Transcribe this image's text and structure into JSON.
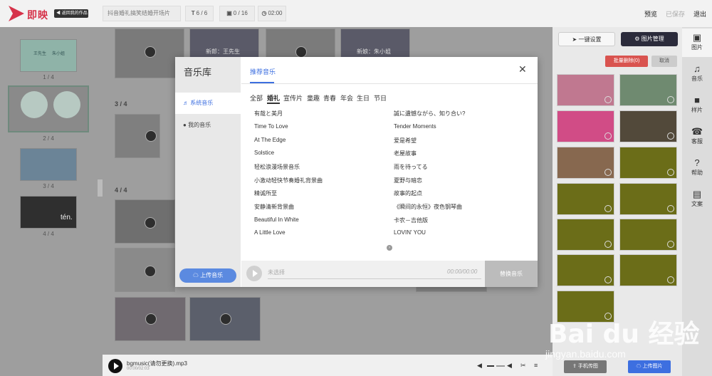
{
  "app": {
    "logo_text": "即映",
    "back_label": "返回我的作品",
    "project_title": "抖音婚礼搞笑结婚开场片",
    "text_count": "6 / 6",
    "image_count": "0 / 16",
    "duration": "02:00",
    "preview_label": "预览",
    "saved_label": "已保存",
    "exit_label": "退出"
  },
  "pages": {
    "labels": [
      "1 / 4",
      "2 / 4",
      "3 / 4",
      "4 / 4"
    ],
    "thumb_text": {
      "groom": "王先生",
      "bride": "朱小姐",
      "tile_caption": "tén."
    }
  },
  "canvas": {
    "section_3": "3 / 4",
    "section_4": "4 / 4",
    "groom_caption": "新郎：王先生",
    "bride_caption": "新娘：朱小姐"
  },
  "bottom": {
    "music_name": "bgmusic(请勿更换).mp3",
    "music_time": "00:00/02:03"
  },
  "right_panel": {
    "one_click_label": "一键设置",
    "image_mgmt_label": "图片管理",
    "batch_delete_label": "批量删除(0)",
    "cancel_label": "取消",
    "phone_upload_label": "手机传图",
    "upload_image_label": "上传图片"
  },
  "side_tabs": [
    {
      "label": "图片",
      "icon": "image-icon"
    },
    {
      "label": "音乐",
      "icon": "music-icon"
    },
    {
      "label": "样片",
      "icon": "video-icon"
    },
    {
      "label": "客服",
      "icon": "support-icon"
    },
    {
      "label": "帮助",
      "icon": "help-icon"
    },
    {
      "label": "文案",
      "icon": "document-icon"
    }
  ],
  "modal": {
    "title": "音乐库",
    "nav": [
      "系统音乐",
      "我的音乐"
    ],
    "upload_label": "上传音乐",
    "tab": "推荐音乐",
    "categories": [
      "全部",
      "婚礼",
      "宣传片",
      "童趣",
      "青春",
      "年会",
      "生日",
      "节日"
    ],
    "active_category": "婚礼",
    "songs_left": [
      "有哉と美月",
      "Time To Love",
      "At The Edge",
      "Solstice",
      "轻松浪漫场景音乐",
      "小激动轻快节奏婚礼背景曲",
      "精诚所至",
      "安静清新背景曲",
      "Beautiful In White",
      "A Little Love"
    ],
    "songs_right": [
      "誠に遺憾ながら、知り合い?",
      "Tender Moments",
      "爱是希望",
      "老屋故事",
      "雨を待ってる",
      "夏野与暗恋",
      "故事的起点",
      "《瞬间的永恒》夜色钢琴曲",
      "卡农－吉他版",
      "LOVIN' YOU"
    ],
    "player_label": "未选择",
    "player_time": "00:00/00:00",
    "replace_label": "替换音乐",
    "pager_icon": "chevron-right-icon"
  },
  "watermark": {
    "brand": "Bai du 经验",
    "url": "jingyan.baidu.com"
  },
  "colors": {
    "accent": "#3d6fe0",
    "brand": "#d6334a",
    "danger": "#d9534f",
    "dark_button": "#2b2b3b"
  }
}
